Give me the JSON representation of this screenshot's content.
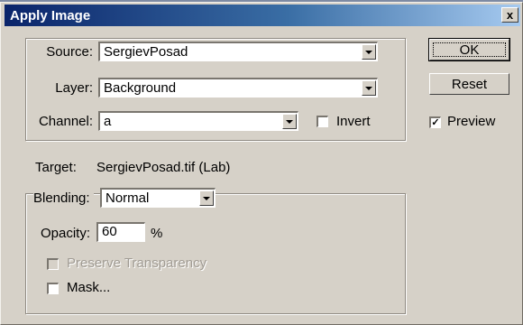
{
  "window": {
    "title": "Apply Image",
    "close_label": "x"
  },
  "source": {
    "label": "Source:",
    "file": "SergievPosad",
    "layer_label": "Layer:",
    "layer": "Background",
    "channel_label": "Channel:",
    "channel": "a",
    "invert_label": "Invert",
    "invert_checked": false
  },
  "target": {
    "label": "Target:",
    "value": "SergievPosad.tif (Lab)"
  },
  "blending": {
    "label": "Blending:",
    "mode": "Normal",
    "opacity_label": "Opacity:",
    "opacity": "60",
    "opacity_unit": "%",
    "preserve_label": "Preserve Transparency",
    "preserve_checked": false,
    "preserve_enabled": false,
    "mask_label": "Mask...",
    "mask_checked": false
  },
  "buttons": {
    "ok": "OK",
    "reset": "Reset"
  },
  "preview": {
    "label": "Preview",
    "checked": true,
    "check_glyph": "✓"
  }
}
